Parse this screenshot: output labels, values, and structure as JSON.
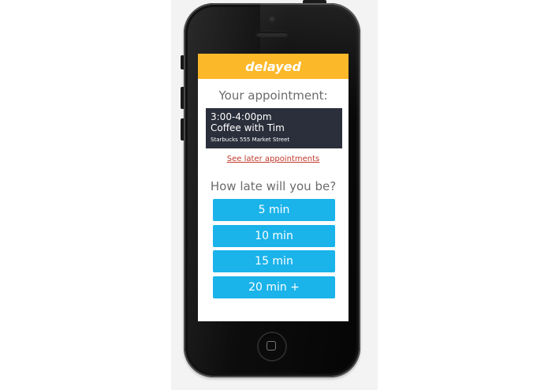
{
  "app": {
    "brand": "delayed"
  },
  "appointment": {
    "heading": "Your appointment:",
    "time": "3:00-4:00pm",
    "title": "Coffee with Tim",
    "location": "Starbucks 555 Market Street",
    "later_link": "See later appointments"
  },
  "lateness": {
    "question": "How late will you be?",
    "options": [
      {
        "label": "5 min"
      },
      {
        "label": "10 min"
      },
      {
        "label": "15 min"
      },
      {
        "label": "20 min +"
      }
    ]
  },
  "colors": {
    "header": "#fbb829",
    "card": "#2b2f3b",
    "button": "#1ab3ea",
    "link": "#c0392b",
    "heading_text": "#6b6b6b"
  }
}
